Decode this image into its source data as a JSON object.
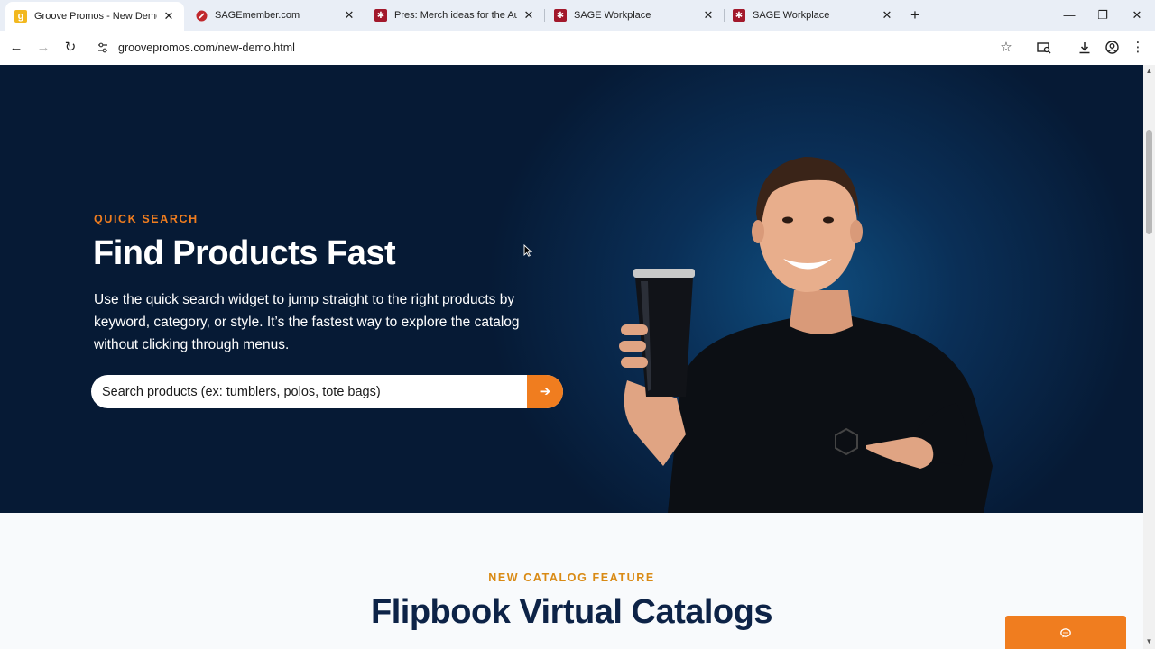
{
  "browser": {
    "tabs": [
      {
        "title": "Groove Promos - New Demo",
        "active": true,
        "favicon": "groove-g-icon"
      },
      {
        "title": "SAGEmember.com",
        "active": false,
        "favicon": "sage-member-icon"
      },
      {
        "title": "Pres: Merch ideas for the Austi",
        "active": false,
        "favicon": "sage-star-icon"
      },
      {
        "title": "SAGE Workplace",
        "active": false,
        "favicon": "sage-star-icon"
      },
      {
        "title": "SAGE Workplace",
        "active": false,
        "favicon": "sage-star-icon"
      }
    ],
    "url": "groovepromos.com/new-demo.html"
  },
  "hero": {
    "eyebrow": "QUICK SEARCH",
    "title": "Find Products Fast",
    "description": "Use the quick search widget to jump straight to the right products by keyword, category, or style. It’s the fastest way to explore the catalog without clicking through menus.",
    "search_placeholder": "Search products (ex: tumblers, polos, tote bags)",
    "search_button_icon": "arrow-right-icon"
  },
  "catalog_section": {
    "eyebrow": "NEW CATALOG FEATURE",
    "title": "Flipbook Virtual Catalogs"
  },
  "chat": {
    "icon": "chat-bubble-icon"
  },
  "colors": {
    "accent": "#f07d1f",
    "hero_bg": "#061a35",
    "heading_navy": "#0d2347",
    "eyebrow_gold": "#d98a14"
  }
}
